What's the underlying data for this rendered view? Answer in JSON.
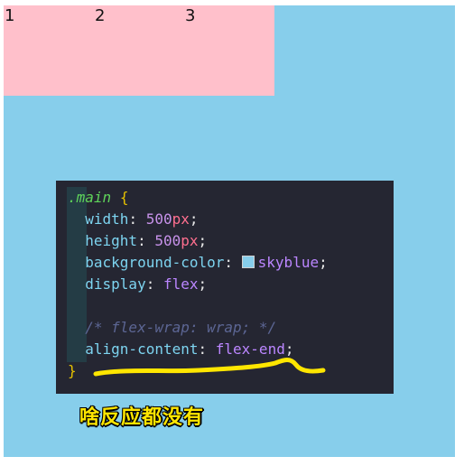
{
  "items": [
    "1",
    "2",
    "3"
  ],
  "code": {
    "selector": ".main",
    "open_brace": "{",
    "close_brace": "}",
    "lines": [
      {
        "prop": "width",
        "num": "500",
        "unit": "px"
      },
      {
        "prop": "height",
        "num": "500",
        "unit": "px"
      },
      {
        "prop": "background-color",
        "value": "skyblue",
        "swatch_color": "#87ceeb"
      },
      {
        "prop": "display",
        "value": "flex"
      },
      {
        "comment": "/* flex-wrap: wrap; */"
      },
      {
        "prop": "align-content",
        "value": "flex-end"
      }
    ]
  },
  "caption": "啥反应都没有",
  "colors": {
    "container": "#87ceeb",
    "item": "#ffc0cb",
    "editor_bg": "#252632",
    "annotation": "#ffe600"
  }
}
